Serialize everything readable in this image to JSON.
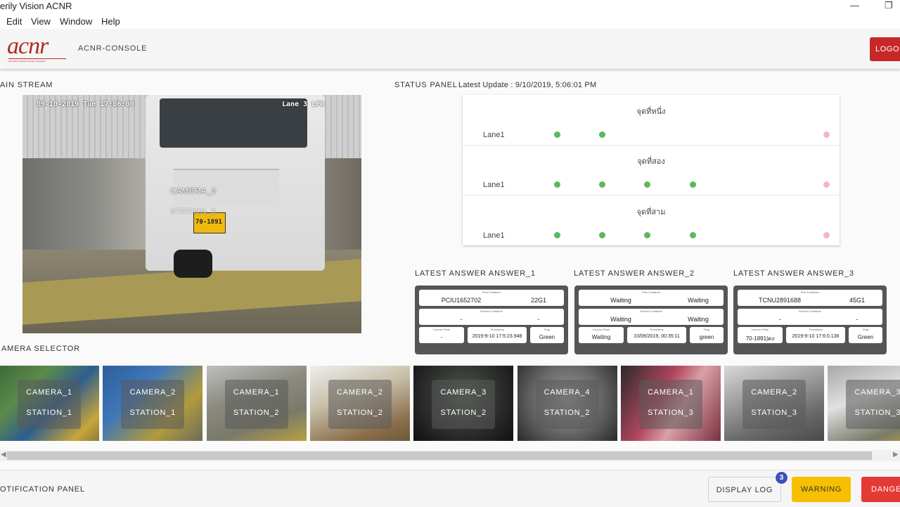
{
  "window": {
    "title": "erily Vision ACNR",
    "minimize_glyph": "—",
    "restore_glyph": "❐"
  },
  "menu": [
    "Edit",
    "View",
    "Window",
    "Help"
  ],
  "header": {
    "logo_text": "acnr",
    "logo_tagline": "automatic container number recognition",
    "console_label": "ACNR-CONSOLE",
    "logout_label": "LOGOU"
  },
  "main_stream": {
    "label": "AIN STREAM",
    "overlay_datetime": "09-10-2019 Tue 17:06:00",
    "overlay_lane": "Lane 3 LPR",
    "camera_label": "CAMERA_3",
    "station_label": "STATION_3",
    "plate_text": "70-1891"
  },
  "status_panel": {
    "label": "STATUS PANEL",
    "latest_update": "Latest Update : 9/10/2019, 5:06:01 PM",
    "points": [
      {
        "title": "จุดที่หนึ่ง",
        "lane": "Lane1",
        "dots": [
          "green",
          "green",
          "",
          "",
          "pink"
        ]
      },
      {
        "title": "จุดที่สอง",
        "lane": "Lane1",
        "dots": [
          "green",
          "green",
          "green",
          "green",
          "pink"
        ]
      },
      {
        "title": "จุดที่สาม",
        "lane": "Lane1",
        "dots": [
          "green",
          "green",
          "green",
          "green",
          "pink"
        ]
      }
    ]
  },
  "answers": [
    {
      "title": "LATEST ANSWER ANSWER_1",
      "first_caption": "First Container",
      "first_a": "PCIU1652702",
      "first_b": "22G1",
      "second_caption": "Second Container",
      "second_a": "-",
      "second_b": "-",
      "plate_caption": "License Plate",
      "plate": "-",
      "timestamp_caption": "Timestamp",
      "timestamp": "2019-9-10 17:5:23.948",
      "flag_caption": "Flag",
      "flag": "Green"
    },
    {
      "title": "LATEST ANSWER ANSWER_2",
      "first_caption": "First Container",
      "first_a": "Waiting",
      "first_b": "Waiting",
      "second_caption": "Second Container",
      "second_a": "Waiting",
      "second_b": "Waiting",
      "plate_caption": "License Plate",
      "plate": "Waiting",
      "timestamp_caption": "Timestamp",
      "timestamp": "10/09/2019, 00:35:11",
      "flag_caption": "Flag",
      "flag": "green"
    },
    {
      "title": "LATEST ANSWER ANSWER_3",
      "first_caption": "First Container",
      "first_a": "TCNU2891688",
      "first_b": "45G1",
      "second_caption": "Second Container",
      "second_a": "-",
      "second_b": "-",
      "plate_caption": "License Plate",
      "plate": "70-1891|ตง",
      "timestamp_caption": "Timestamp",
      "timestamp": "2019-9-10 17:6:0.136",
      "flag_caption": "Flag",
      "flag": "Green"
    }
  ],
  "camera_selector": {
    "label": "AMERA SELECTOR",
    "cameras": [
      {
        "camera": "CAMERA_1",
        "station": "STATION_1"
      },
      {
        "camera": "CAMERA_2",
        "station": "STATION_1"
      },
      {
        "camera": "CAMERA_1",
        "station": "STATION_2"
      },
      {
        "camera": "CAMERA_2",
        "station": "STATION_2"
      },
      {
        "camera": "CAMERA_3",
        "station": "STATION_2"
      },
      {
        "camera": "CAMERA_4",
        "station": "STATION_2"
      },
      {
        "camera": "CAMERA_1",
        "station": "STATION_3"
      },
      {
        "camera": "CAMERA_2",
        "station": "STATION_3"
      },
      {
        "camera": "CAMERA_3",
        "station": "STATION_3"
      }
    ]
  },
  "notification": {
    "label": "OTIFICATION PANEL",
    "display_log_label": "DISPLAY LOG",
    "badge_count": "3",
    "warning_label": "WARNING",
    "danger_label": "DANGE"
  },
  "colors": {
    "brand": "#b02a22",
    "logout": "#c62828",
    "status_green": "#5cb85c",
    "status_pink": "#f4b7bd",
    "warning": "#f6c000",
    "danger": "#e53935",
    "badge": "#3f51b5"
  }
}
